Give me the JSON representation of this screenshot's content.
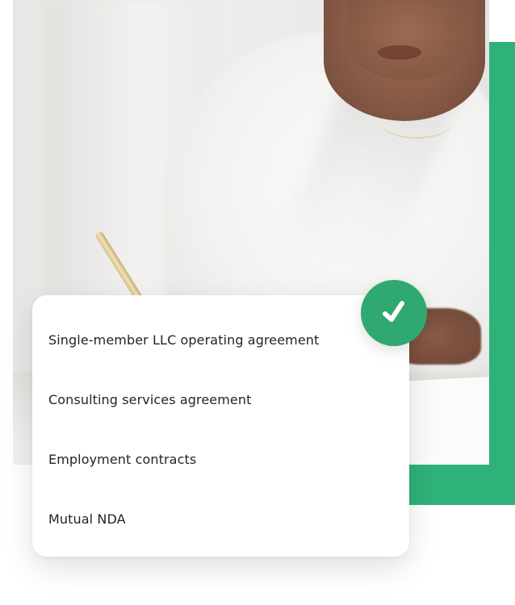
{
  "colors": {
    "accent_green": "#2fb27a",
    "badge_green": "#2fa96f",
    "card_background": "#ffffff",
    "text": "#222427"
  },
  "photo": {
    "subject": "woman-in-white-robe-writing-with-pen"
  },
  "badge": {
    "icon": "checkmark-icon"
  },
  "agreements": [
    {
      "label": "Single-member LLC operating agreement"
    },
    {
      "label": "Consulting services agreement"
    },
    {
      "label": "Employment contracts"
    },
    {
      "label": "Mutual NDA"
    }
  ]
}
